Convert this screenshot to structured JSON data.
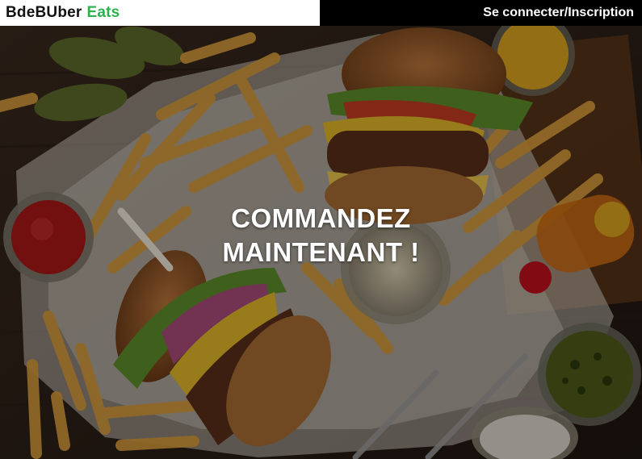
{
  "header": {
    "brand_primary": "BdeBUber",
    "brand_secondary": "Eats",
    "login_label": "Se connecter/Inscription"
  },
  "hero": {
    "title_line1": "COMMANDEZ",
    "title_line2": "MAINTENANT !",
    "image_subject": "burgers-and-fries-photo"
  },
  "colors": {
    "brand_accent": "#2bb24c",
    "header_bg": "#000000",
    "brand_bg": "#ffffff"
  }
}
